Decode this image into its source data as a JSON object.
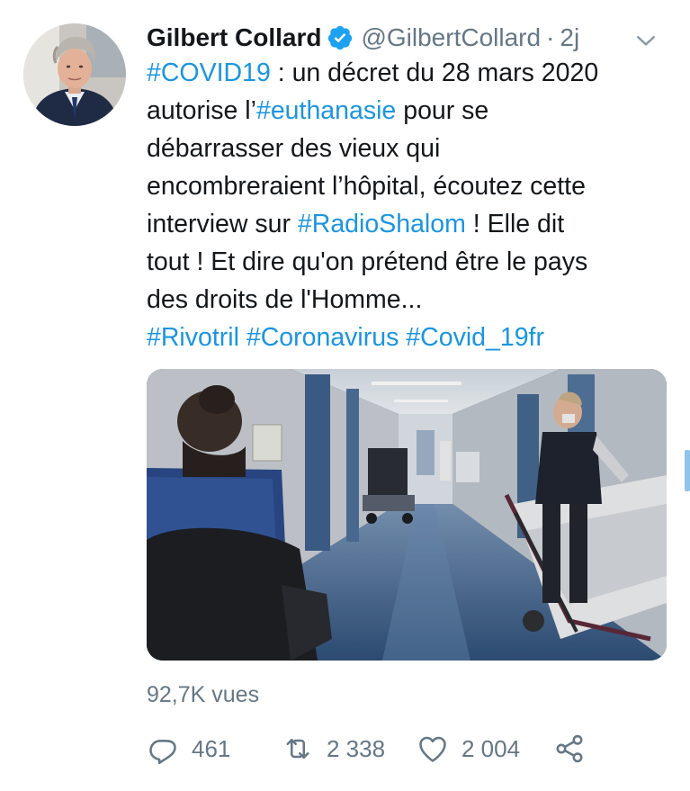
{
  "tweet": {
    "author": {
      "name": "Gilbert Collard",
      "handle": "@GilbertCollard",
      "time": "2j",
      "separator": "·",
      "verified": true,
      "avatar_icon": "profile-photo-man-suit"
    },
    "text_lines": [
      [
        {
          "t": "#COVID19",
          "tag": true
        },
        {
          "t": " : un décret du 28 mars 2020",
          "tag": false
        }
      ],
      [
        {
          "t": "autorise l’",
          "tag": false
        },
        {
          "t": "#euthanasie",
          "tag": true
        },
        {
          "t": " pour se",
          "tag": false
        }
      ],
      [
        {
          "t": "débarrasser des vieux qui",
          "tag": false
        }
      ],
      [
        {
          "t": "encombreraient l’hôpital, écoutez cette",
          "tag": false
        }
      ],
      [
        {
          "t": "interview sur ",
          "tag": false
        },
        {
          "t": "#RadioShalom",
          "tag": true
        },
        {
          "t": " ! Elle dit",
          "tag": false
        }
      ],
      [
        {
          "t": "tout ! Et dire qu'on prétend être le pays",
          "tag": false
        }
      ],
      [
        {
          "t": "des droits de l'Homme...",
          "tag": false
        }
      ],
      [
        {
          "t": "#Rivotril",
          "tag": true
        },
        {
          "t": " ",
          "tag": false
        },
        {
          "t": "#Coronavirus",
          "tag": true
        },
        {
          "t": " ",
          "tag": false
        },
        {
          "t": "#Covid_19fr",
          "tag": true
        }
      ]
    ],
    "media": {
      "type": "photo",
      "icon": "hospital-corridor-photo"
    },
    "views": "92,7K vues",
    "actions": {
      "reply_count": "461",
      "retweet_count": "2 338",
      "like_count": "2 004"
    }
  },
  "colors": {
    "hashtag": "#1b95e0",
    "secondary_text": "#657786",
    "verified_badge": "#1da1f2",
    "primary_text": "#14171a"
  }
}
